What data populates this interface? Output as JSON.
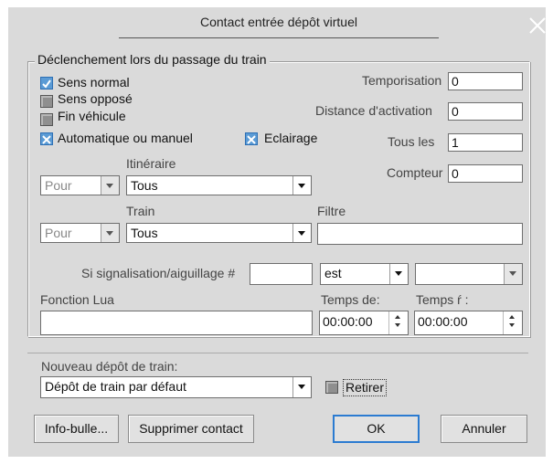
{
  "dialog": {
    "title": "Contact entrée dépôt virtuel",
    "close_label": "×"
  },
  "trigger_group": {
    "legend": "Déclenchement lors du passage du train",
    "checkboxes": [
      {
        "label": "Sens normal",
        "state": "checked"
      },
      {
        "label": "Sens opposé",
        "state": "disabled"
      },
      {
        "label": "Fin véhicule",
        "state": "disabled"
      },
      {
        "label": "Automatique ou manuel",
        "state": "x"
      },
      {
        "label": "Eclairage",
        "state": "x"
      }
    ],
    "fields": {
      "temporisation": {
        "label": "Temporisation",
        "value": "0"
      },
      "distance": {
        "label": "Distance d'activation",
        "value": "0"
      },
      "tous_les": {
        "label": "Tous les",
        "value": "1"
      },
      "compteur": {
        "label": "Compteur",
        "value": "0"
      }
    },
    "itineraire": {
      "label": "Itinéraire",
      "mode": "Pour",
      "value": "Tous"
    },
    "train": {
      "label": "Train",
      "mode": "Pour",
      "value": "Tous"
    },
    "filtre": {
      "label": "Filtre",
      "value": ""
    },
    "signal": {
      "label": "Si signalisation/aiguillage #",
      "number": "",
      "operator": "est",
      "state": ""
    },
    "lua": {
      "label": "Fonction Lua",
      "value": ""
    },
    "temps_de": {
      "label": "Temps de:",
      "value": "00:00:00"
    },
    "temps_a": {
      "label": "Temps ŕ :",
      "value": "00:00:00"
    }
  },
  "depot": {
    "label": "Nouveau dépôt de train:",
    "value": "Dépôt de train par défaut",
    "retirer_label": "Retirer"
  },
  "buttons": {
    "info": "Info-bulle...",
    "delete": "Supprimer contact",
    "ok": "OK",
    "cancel": "Annuler"
  }
}
